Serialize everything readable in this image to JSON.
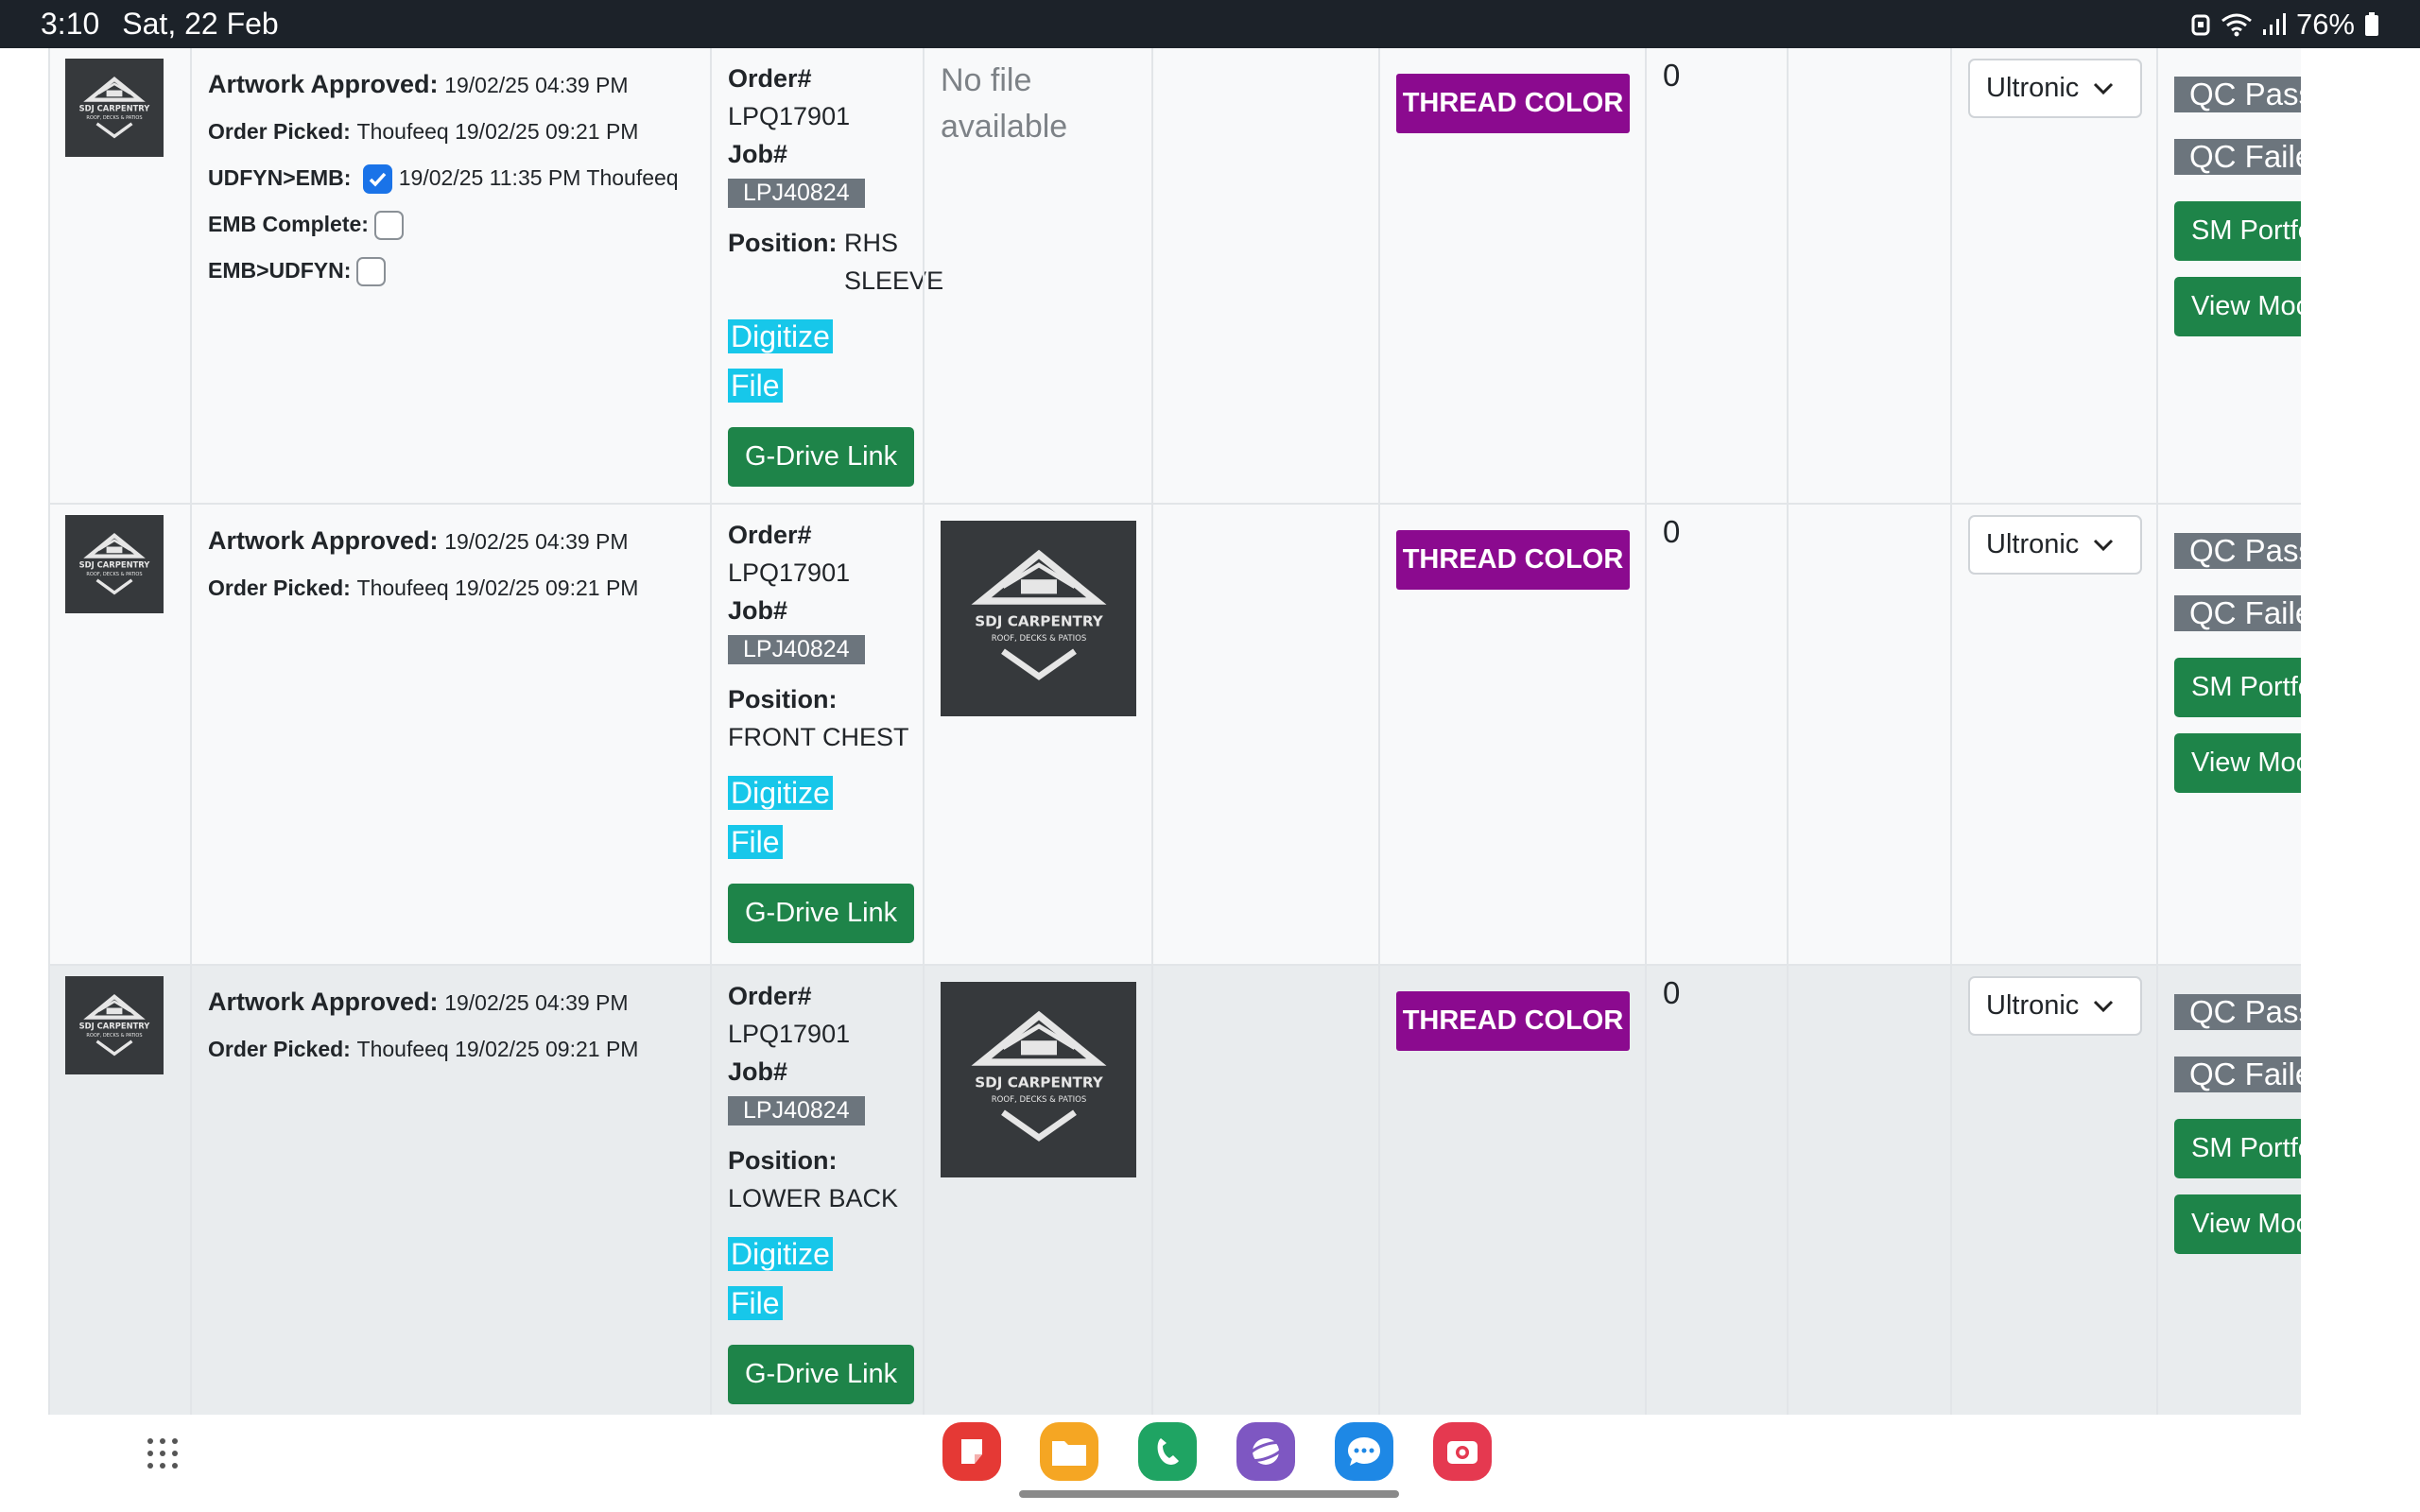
{
  "status_bar": {
    "time": "3:10",
    "date": "Sat, 22 Feb",
    "battery": "76%"
  },
  "logo_text": {
    "line1": "SDJ CARPENTRY",
    "line2": "ROOF, DECKS & PATIOS"
  },
  "rows": [
    {
      "artwork_label": "Artwork Approved:",
      "artwork_value": "19/02/25 04:39 PM",
      "picked_label": "Order Picked:",
      "picked_value": "Thoufeeq 19/02/25 09:21 PM",
      "udfyn_emb_label": "UDFYN>EMB:",
      "udfyn_emb_checked": true,
      "udfyn_emb_value": "19/02/25 11:35 PM Thoufeeq",
      "emb_complete_label": "EMB Complete:",
      "emb_udfyn_label": "EMB>UDFYN:",
      "order_label": "Order#",
      "order_value": "LPQ17901",
      "job_label": "Job#",
      "job_value": "LPJ40824",
      "position_label": "Position:",
      "position_value": "RHS SLEEVE",
      "digitize_line1": "Digitize",
      "digitize_line2": "File",
      "gdrive": "G-Drive Link",
      "file_text": "No file available",
      "thread": "THREAD COLOR",
      "qty": "0",
      "select_value": "Ultronic",
      "qc_pass": "QC Pass",
      "qc_failed": "QC Failed",
      "sm_portfolio": "SM Portfolio",
      "view_mockup": "View Mockup"
    },
    {
      "artwork_label": "Artwork Approved:",
      "artwork_value": "19/02/25 04:39 PM",
      "picked_label": "Order Picked:",
      "picked_value": "Thoufeeq 19/02/25 09:21 PM",
      "order_label": "Order#",
      "order_value": "LPQ17901",
      "job_label": "Job#",
      "job_value": "LPJ40824",
      "position_label": "Position:",
      "position_value": "FRONT CHEST",
      "digitize_line1": "Digitize",
      "digitize_line2": "File",
      "gdrive": "G-Drive Link",
      "thread": "THREAD COLOR",
      "qty": "0",
      "select_value": "Ultronic",
      "qc_pass": "QC Pass",
      "qc_failed": "QC Failed",
      "sm_portfolio": "SM Portfolio",
      "view_mockup": "View Mockup"
    },
    {
      "artwork_label": "Artwork Approved:",
      "artwork_value": "19/02/25 04:39 PM",
      "picked_label": "Order Picked:",
      "picked_value": "Thoufeeq 19/02/25 09:21 PM",
      "order_label": "Order#",
      "order_value": "LPQ17901",
      "job_label": "Job#",
      "job_value": "LPJ40824",
      "position_label": "Position:",
      "position_value": "LOWER BACK",
      "digitize_line1": "Digitize",
      "digitize_line2": "File",
      "gdrive": "G-Drive Link",
      "thread": "THREAD COLOR",
      "qty": "0",
      "select_value": "Ultronic",
      "qc_pass": "QC Pass",
      "qc_failed": "QC Failed",
      "sm_portfolio": "SM Portfolio",
      "view_mockup": "View Mockup"
    }
  ],
  "dock_apps": [
    "notes-app",
    "my-files-app",
    "phone-app",
    "internet-app",
    "messages-app",
    "screen-recorder-app"
  ],
  "colors": {
    "thread_purple": "#8b0a8f",
    "gdrive_green": "#1e8449",
    "digitize_cyan": "#17c7ea",
    "badge_gray": "#6c757d"
  }
}
